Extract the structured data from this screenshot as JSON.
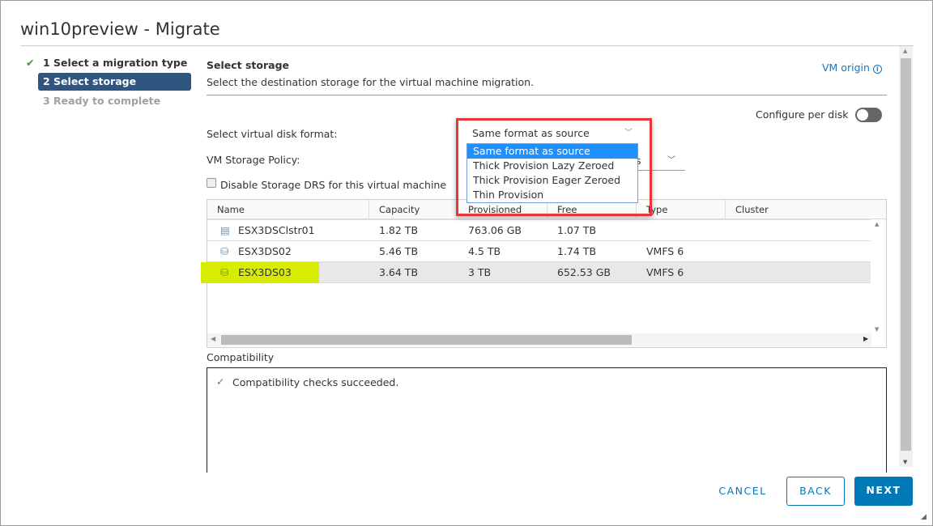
{
  "dialog": {
    "title": "win10preview - Migrate"
  },
  "steps": [
    {
      "label": "1 Select a migration type",
      "state": "done"
    },
    {
      "label": "2 Select storage",
      "state": "active"
    },
    {
      "label": "3 Ready to complete",
      "state": "future"
    }
  ],
  "main": {
    "heading": "Select storage",
    "description": "Select the destination storage for the virtual machine migration.",
    "vm_origin": "VM origin",
    "configure_per_disk": "Configure per disk",
    "configure_per_disk_on": false,
    "disk_format_label": "Select virtual disk format:",
    "disk_format_value": "Same format as source",
    "disk_format_options": [
      "Same format as source",
      "Thick Provision Lazy Zoroed",
      "Thick Provision Eager Zeroed",
      "Thin Provision"
    ],
    "storage_policy_label": "VM Storage Policy:",
    "storage_policy_visible_text": "s",
    "disable_drs_label": "Disable Storage DRS for this virtual machine",
    "disable_drs_checked": false
  },
  "table": {
    "columns": [
      "Name",
      "Capacity",
      "Provisioned",
      "Free",
      "Type",
      "Cluster"
    ],
    "rows": [
      {
        "icon": "datastore-cluster-icon",
        "name": "ESX3DSClstr01",
        "capacity": "1.82 TB",
        "provisioned": "763.06 GB",
        "free": "1.07 TB",
        "type": "",
        "cluster": ""
      },
      {
        "icon": "datastore-icon",
        "name": "ESX3DS02",
        "capacity": "5.46 TB",
        "provisioned": "4.5 TB",
        "free": "1.74 TB",
        "type": "VMFS 6",
        "cluster": ""
      },
      {
        "icon": "datastore-icon",
        "name": "ESX3DS03",
        "capacity": "3.64 TB",
        "provisioned": "3 TB",
        "free": "652.53 GB",
        "type": "VMFS 6",
        "cluster": "",
        "selected": true
      }
    ]
  },
  "compatibility": {
    "label": "Compatibility",
    "message": "Compatibility checks succeeded."
  },
  "buttons": {
    "cancel": "CANCEL",
    "back": "BACK",
    "next": "NEXT"
  },
  "colors": {
    "accent": "#0079b8",
    "step_active": "#2f5580",
    "highlight": "#d7ec00",
    "callout": "#e8343b",
    "success": "#3c9a2e"
  }
}
